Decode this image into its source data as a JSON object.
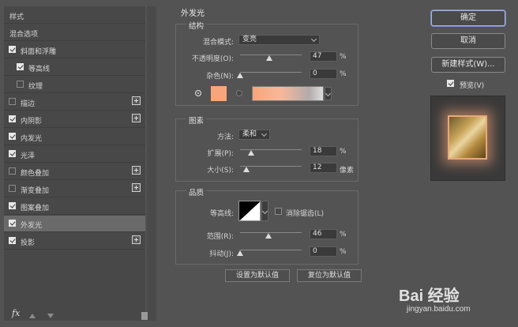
{
  "sidebar": {
    "items": [
      {
        "label": "样式",
        "checkbox": null,
        "plus": false
      },
      {
        "label": "混合选项",
        "checkbox": null,
        "plus": false
      },
      {
        "label": "斜面和浮雕",
        "checkbox": true,
        "plus": false
      },
      {
        "label": "等高线",
        "checkbox": true,
        "plus": false
      },
      {
        "label": "纹理",
        "checkbox": false,
        "plus": false
      },
      {
        "label": "描边",
        "checkbox": false,
        "plus": true
      },
      {
        "label": "内阴影",
        "checkbox": true,
        "plus": true
      },
      {
        "label": "内发光",
        "checkbox": true,
        "plus": false
      },
      {
        "label": "光泽",
        "checkbox": true,
        "plus": false
      },
      {
        "label": "颜色叠加",
        "checkbox": false,
        "plus": true
      },
      {
        "label": "渐变叠加",
        "checkbox": false,
        "plus": true
      },
      {
        "label": "图案叠加",
        "checkbox": true,
        "plus": false
      },
      {
        "label": "外发光",
        "checkbox": true,
        "plus": false,
        "selected": true
      },
      {
        "label": "投影",
        "checkbox": true,
        "plus": true
      }
    ],
    "footer_fx": "fx"
  },
  "panel": {
    "title": "外发光",
    "structure": {
      "title": "结构",
      "blend_mode_label": "混合模式:",
      "blend_mode_value": "变亮",
      "opacity_label": "不透明度(O):",
      "opacity_value": "47",
      "opacity_percent": 0.47,
      "noise_label": "杂色(N):",
      "noise_value": "0",
      "noise_percent": 0,
      "percent_unit": "%",
      "swatch_color": "#f7a57a"
    },
    "elements": {
      "title": "图素",
      "technique_label": "方法:",
      "technique_value": "柔和",
      "spread_label": "扩展(P):",
      "spread_value": "18",
      "spread_percent": 0.18,
      "size_label": "大小(S):",
      "size_value": "12",
      "size_unit": "像素",
      "percent_unit": "%"
    },
    "quality": {
      "title": "品质",
      "contour_label": "等高线:",
      "antialias_label": "消除锯齿(L)",
      "range_label": "范围(R):",
      "range_value": "46",
      "range_percent": 0.46,
      "jitter_label": "抖动(J):",
      "jitter_value": "0",
      "jitter_percent": 0,
      "percent_unit": "%"
    },
    "buttons": {
      "make_default": "设置为默认值",
      "reset_default": "复位为默认值"
    }
  },
  "right": {
    "ok": "确定",
    "cancel": "取消",
    "new_style": "新建样式(W)...",
    "preview_label": "预览(V)"
  },
  "watermark": {
    "brand": "Bai 经验",
    "url": "jingyan.baidu.com"
  }
}
